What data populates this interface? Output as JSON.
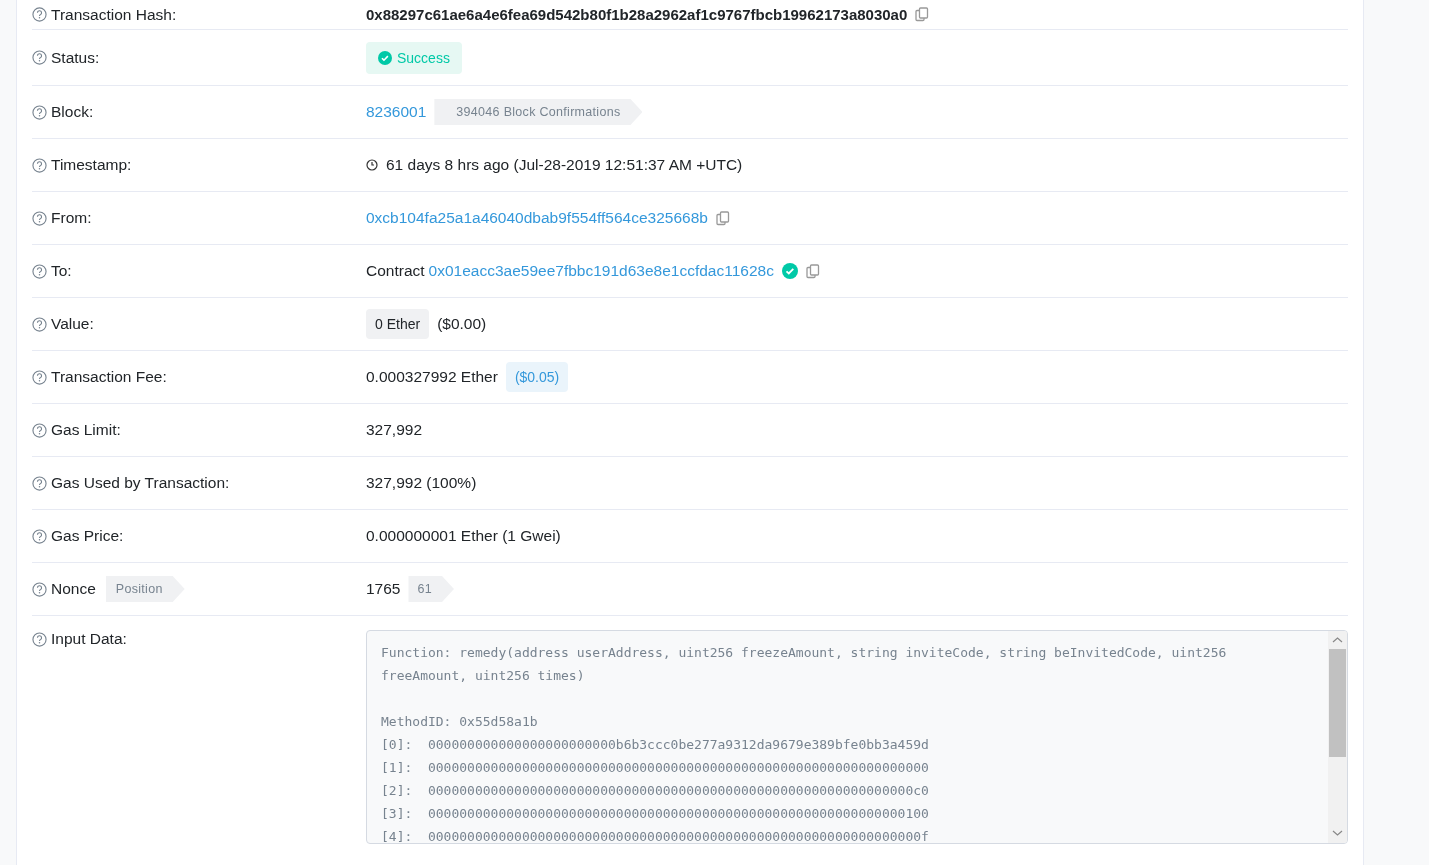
{
  "rows": [
    {
      "kind": "hash",
      "label": "Transaction Hash:",
      "value": "0x88297c61ae6a4e6fea69d542b80f1b28a2962af1c9767fbcb19962173a8030a0"
    },
    {
      "kind": "status",
      "label": "Status:",
      "value": "Success"
    },
    {
      "kind": "block",
      "label": "Block:",
      "value": "8236001",
      "badge": "394046 Block Confirmations"
    },
    {
      "kind": "timestamp",
      "label": "Timestamp:",
      "value": "61 days 8 hrs ago (Jul-28-2019 12:51:37 AM +UTC)"
    },
    {
      "kind": "address",
      "label": "From:",
      "value": "0xcb104fa25a1a46040dbab9f554ff564ce325668b"
    },
    {
      "kind": "contract",
      "label": "To:",
      "prefix": "Contract",
      "value": "0x01eacc3ae59ee7fbbc191d63e8e1ccfdac11628c",
      "verified": true
    },
    {
      "kind": "value",
      "label": "Value:",
      "value": "0 Ether",
      "usd": "($0.00)"
    },
    {
      "kind": "fee",
      "label": "Transaction Fee:",
      "value": "0.000327992 Ether",
      "usd": "($0.05)"
    },
    {
      "kind": "plain",
      "label": "Gas Limit:",
      "value": "327,992"
    },
    {
      "kind": "plain",
      "label": "Gas Used by Transaction:",
      "value": "327,992 (100%)"
    },
    {
      "kind": "plain",
      "label": "Gas Price:",
      "value": "0.000000001 Ether (1 Gwei)"
    },
    {
      "kind": "nonce",
      "label": "Nonce",
      "label_badge": "Position",
      "value": "1765",
      "badge": "61"
    },
    {
      "kind": "input",
      "label": "Input Data:",
      "function_lines": [
        "Function: remedy(address userAddress, uint256 freezeAmount, string inviteCode, string beInvitedCode, uint256",
        "freeAmount, uint256 times)"
      ],
      "lines": [
        "MethodID: 0x55d58a1b",
        "[0]:  000000000000000000000000b6b3ccc0be277a9312da9679e389bfe0bb3a459d",
        "[1]:  0000000000000000000000000000000000000000000000000000000000000000",
        "[2]:  00000000000000000000000000000000000000000000000000000000000000c0",
        "[3]:  0000000000000000000000000000000000000000000000000000000000000100",
        "[4]:  000000000000000000000000000000000000000000000000000000000000000f"
      ]
    }
  ]
}
